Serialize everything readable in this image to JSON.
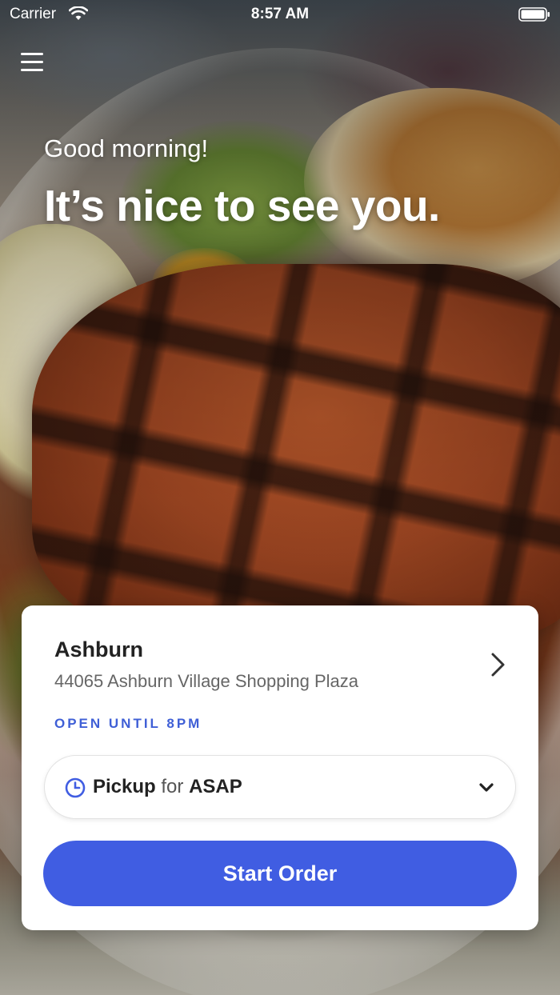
{
  "status_bar": {
    "carrier": "Carrier",
    "time": "8:57 AM",
    "wifi_icon": "wifi-icon",
    "battery_icon": "battery-icon"
  },
  "header": {
    "menu_icon": "hamburger-menu-icon",
    "greeting": "Good morning!",
    "headline": "It’s nice to see you."
  },
  "location_card": {
    "name": "Ashburn",
    "address": "44065 Ashburn Village Shopping Plaza",
    "hours": "OPEN UNTIL 8PM",
    "chevron_icon": "chevron-right-icon",
    "order_mode": {
      "clock_icon": "clock-icon",
      "mode": "Pickup",
      "connector": "for",
      "time": "ASAP",
      "dropdown_icon": "chevron-down-icon"
    },
    "start_button": "Start Order"
  },
  "colors": {
    "accent": "#405de2",
    "hours_text": "#3f5fd6",
    "card_bg": "#ffffff"
  }
}
